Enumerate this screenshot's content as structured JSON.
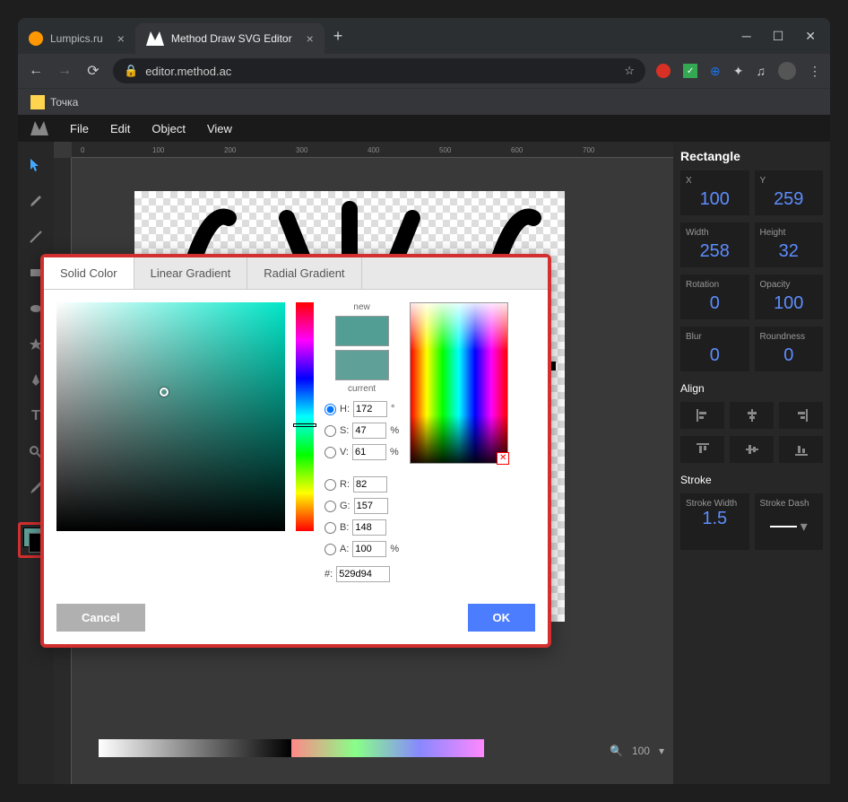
{
  "browser": {
    "tabs": [
      {
        "title": "Lumpics.ru",
        "icon_color": "#ff9800"
      },
      {
        "title": "Method Draw SVG Editor",
        "icon_color": "#fff"
      }
    ],
    "url": "editor.method.ac",
    "bookmark": "Точка"
  },
  "menubar": {
    "file": "File",
    "edit": "Edit",
    "object": "Object",
    "view": "View"
  },
  "ruler_marks": [
    "0",
    "100",
    "200",
    "300",
    "400",
    "500",
    "600",
    "700"
  ],
  "zoom": {
    "value": "100"
  },
  "right_panel": {
    "title": "Rectangle",
    "x": {
      "label": "X",
      "value": "100"
    },
    "y": {
      "label": "Y",
      "value": "259"
    },
    "width": {
      "label": "Width",
      "value": "258"
    },
    "height": {
      "label": "Height",
      "value": "32"
    },
    "rotation": {
      "label": "Rotation",
      "value": "0"
    },
    "opacity": {
      "label": "Opacity",
      "value": "100"
    },
    "blur": {
      "label": "Blur",
      "value": "0"
    },
    "roundness": {
      "label": "Roundness",
      "value": "0"
    },
    "align": "Align",
    "stroke": "Stroke",
    "stroke_width": {
      "label": "Stroke Width",
      "value": "1.5"
    },
    "stroke_dash": {
      "label": "Stroke Dash"
    }
  },
  "color_picker": {
    "tabs": {
      "solid": "Solid Color",
      "linear": "Linear Gradient",
      "radial": "Radial Gradient"
    },
    "new_label": "new",
    "current_label": "current",
    "new_color": "#529d94",
    "current_color": "#5fa098",
    "h": {
      "label": "H:",
      "value": "172",
      "unit": "°"
    },
    "s": {
      "label": "S:",
      "value": "47",
      "unit": "%"
    },
    "v": {
      "label": "V:",
      "value": "61",
      "unit": "%"
    },
    "r": {
      "label": "R:",
      "value": "82"
    },
    "g": {
      "label": "G:",
      "value": "157"
    },
    "b": {
      "label": "B:",
      "value": "148"
    },
    "a": {
      "label": "A:",
      "value": "100",
      "unit": "%"
    },
    "hex": {
      "label": "#:",
      "value": "529d94"
    },
    "cancel": "Cancel",
    "ok": "OK"
  }
}
